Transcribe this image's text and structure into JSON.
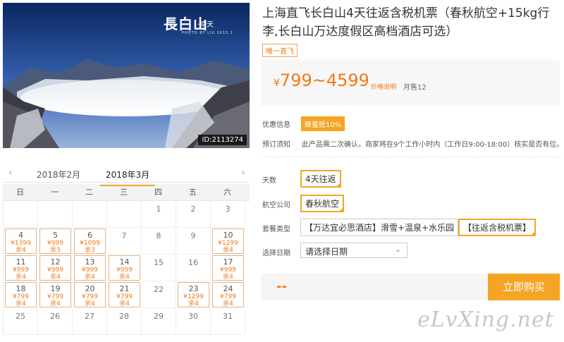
{
  "hero": {
    "logo_text": "長白山",
    "logo_sub": "·晴天",
    "credit": "PHOTO BY LIU 2015.1",
    "image_id": "ID:2113274"
  },
  "calendar": {
    "prev_icon": "chevron-left-icon",
    "next_icon": "chevron-right-icon",
    "months": [
      "2018年2月",
      "2018年3月"
    ],
    "active_month": 1,
    "weekdays": [
      "日",
      "一",
      "二",
      "三",
      "四",
      "五",
      "六"
    ],
    "days": [
      {
        "d": "",
        "p": "",
        "r": ""
      },
      {
        "d": "",
        "p": "",
        "r": ""
      },
      {
        "d": "",
        "p": "",
        "r": ""
      },
      {
        "d": "",
        "p": "",
        "r": ""
      },
      {
        "d": "1",
        "p": "",
        "r": ""
      },
      {
        "d": "2",
        "p": "",
        "r": ""
      },
      {
        "d": "3",
        "p": "",
        "r": ""
      },
      {
        "d": "4",
        "p": "¥1399",
        "r": "余4"
      },
      {
        "d": "5",
        "p": "¥999",
        "r": "余3"
      },
      {
        "d": "6",
        "p": "¥1099",
        "r": "余3"
      },
      {
        "d": "7",
        "p": "",
        "r": ""
      },
      {
        "d": "8",
        "p": "",
        "r": ""
      },
      {
        "d": "9",
        "p": "",
        "r": ""
      },
      {
        "d": "10",
        "p": "¥1299",
        "r": "余4"
      },
      {
        "d": "11",
        "p": "¥999",
        "r": "余4"
      },
      {
        "d": "12",
        "p": "¥999",
        "r": "余4"
      },
      {
        "d": "13",
        "p": "¥999",
        "r": "余4"
      },
      {
        "d": "14",
        "p": "¥999",
        "r": "余4"
      },
      {
        "d": "15",
        "p": "",
        "r": ""
      },
      {
        "d": "16",
        "p": "",
        "r": ""
      },
      {
        "d": "17",
        "p": "¥999",
        "r": "余4"
      },
      {
        "d": "18",
        "p": "¥799",
        "r": "余4"
      },
      {
        "d": "19",
        "p": "¥799",
        "r": "余4"
      },
      {
        "d": "20",
        "p": "¥799",
        "r": "余4"
      },
      {
        "d": "21",
        "p": "¥799",
        "r": "余4"
      },
      {
        "d": "22",
        "p": "",
        "r": ""
      },
      {
        "d": "23",
        "p": "¥1299",
        "r": "余4"
      },
      {
        "d": "24",
        "p": "¥799",
        "r": "余4"
      },
      {
        "d": "25",
        "p": "",
        "r": ""
      },
      {
        "d": "26",
        "p": "",
        "r": ""
      },
      {
        "d": "27",
        "p": "",
        "r": ""
      },
      {
        "d": "28",
        "p": "",
        "r": ""
      },
      {
        "d": "29",
        "p": "",
        "r": ""
      },
      {
        "d": "30",
        "p": "",
        "r": ""
      },
      {
        "d": "31",
        "p": "",
        "r": ""
      }
    ]
  },
  "product": {
    "title": "上海直飞长白山4天往返含税机票（春秋航空+15kg行李,长白山万达度假区高档酒店可选）",
    "tag": "唯一直飞",
    "price_symbol": "¥",
    "price_range": "799~4599",
    "price_note": "价格说明",
    "sold": "月售12"
  },
  "info": {
    "offer_label": "优惠信息",
    "offer_badge": "蜂蜜抵10%",
    "notice_label": "预订须知",
    "notice_text": "此产品需二次确认，商家将在9个工作小时内（工作日9:00-18:00）核实是否有位。"
  },
  "options": {
    "days_label": "天数",
    "days_value": "4天往返",
    "airline_label": "航空公司",
    "airline_value": "春秋航空",
    "package_label": "套餐类型",
    "package_a": "【万达宜必思酒店】滑雪+温泉+水乐园",
    "package_b": "【往返含税机票】",
    "date_label": "选择日期",
    "date_placeholder": "请选择日期",
    "date_chevron": "chevron-down-icon"
  },
  "buy": {
    "price": "--",
    "button": "立即购买"
  },
  "watermark": "eLvXing.net",
  "colors": {
    "accent": "#f5a524",
    "price": "#f07a1a"
  }
}
